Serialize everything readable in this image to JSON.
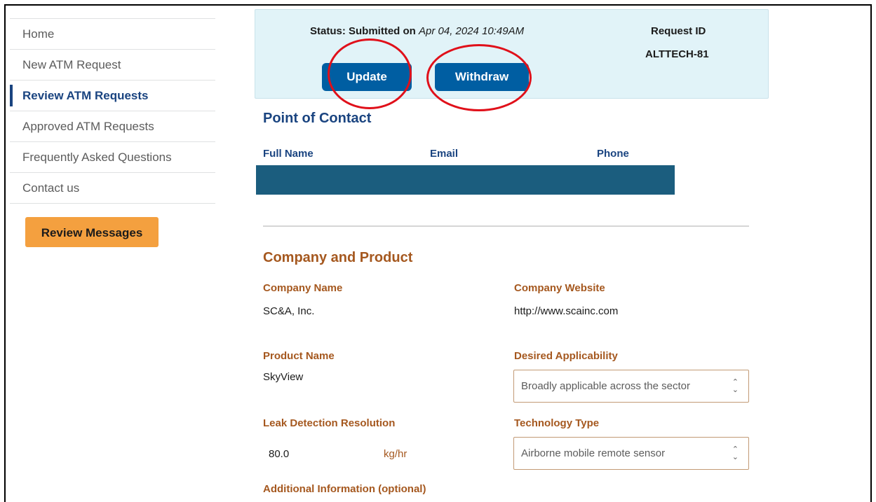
{
  "sidebar": {
    "items": [
      {
        "label": "Home"
      },
      {
        "label": "New ATM Request"
      },
      {
        "label": "Review ATM Requests"
      },
      {
        "label": "Approved ATM Requests"
      },
      {
        "label": "Frequently Asked Questions"
      },
      {
        "label": "Contact us"
      }
    ],
    "active_index": 2,
    "review_messages_label": "Review Messages"
  },
  "status": {
    "prefix": "Status: Submitted on ",
    "date": "Apr 04, 2024 10:49AM",
    "request_id_label": "Request ID",
    "request_id": "ALTTECH-81",
    "update_label": "Update",
    "withdraw_label": "Withdraw"
  },
  "contact": {
    "title": "Point of Contact",
    "columns": [
      "Full Name",
      "Email",
      "Phone"
    ]
  },
  "company": {
    "title": "Company and Product",
    "company_name_label": "Company Name",
    "company_name": "SC&A, Inc.",
    "company_website_label": "Company Website",
    "company_website": "http://www.scainc.com",
    "product_name_label": "Product Name",
    "product_name": "SkyView",
    "desired_applicability_label": "Desired Applicability",
    "desired_applicability": "Broadly applicable across the sector",
    "leak_detection_label": "Leak Detection Resolution",
    "leak_detection_value": "80.0",
    "leak_detection_unit": "kg/hr",
    "technology_type_label": "Technology Type",
    "technology_type": "Airborne mobile remote sensor",
    "additional_info_label": "Additional Information (optional)"
  },
  "colors": {
    "primary": "#005ea2",
    "accent_orange": "#f4a03f",
    "section_orange": "#a5581f",
    "annotation_red": "#e0101a",
    "status_bg": "#e1f3f8"
  }
}
